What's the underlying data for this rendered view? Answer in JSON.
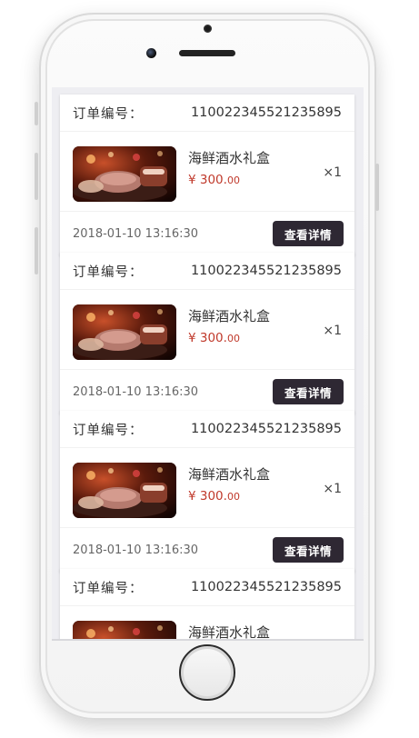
{
  "colors": {
    "price": "#c0392b",
    "button_bg": "#2e2833",
    "screen_bg": "#eeeef2"
  },
  "orders": [
    {
      "order_label": "订单编号：",
      "order_no": "110022345521235895",
      "item_name": "海鲜酒水礼盒",
      "price_main": "¥ 300.",
      "price_cents": "00",
      "qty": "×1",
      "date": "2018-01-10 13:16:30",
      "detail_button": "查看详情"
    },
    {
      "order_label": "订单编号：",
      "order_no": "110022345521235895",
      "item_name": "海鲜酒水礼盒",
      "price_main": "¥ 300.",
      "price_cents": "00",
      "qty": "×1",
      "date": "2018-01-10 13:16:30",
      "detail_button": "查看详情"
    },
    {
      "order_label": "订单编号：",
      "order_no": "110022345521235895",
      "item_name": "海鲜酒水礼盒",
      "price_main": "¥ 300.",
      "price_cents": "00",
      "qty": "×1",
      "date": "2018-01-10 13:16:30",
      "detail_button": "查看详情"
    },
    {
      "order_label": "订单编号：",
      "order_no": "110022345521235895",
      "item_name": "海鲜酒水礼盒"
    }
  ]
}
